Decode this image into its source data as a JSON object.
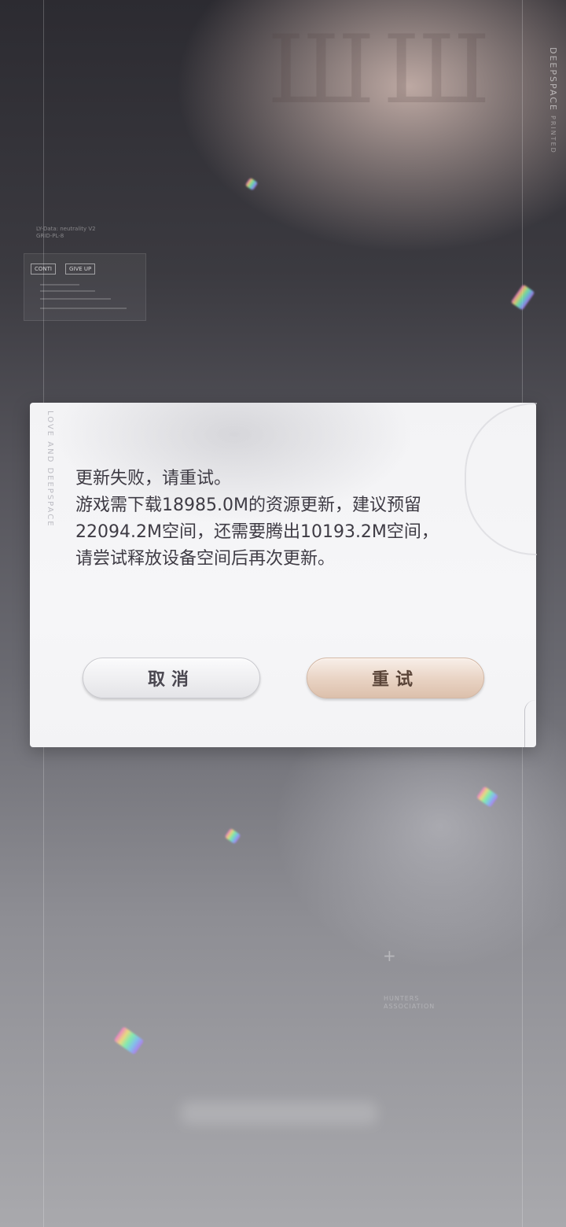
{
  "background": {
    "side_brand": "DEEPSPACE",
    "side_brand_sub": "PRINTED",
    "hud_small_lines": [
      "LY-Data: neutrality V2",
      "GRID-PL-8"
    ],
    "hud_chips": [
      "CONTI",
      "GIVE UP"
    ],
    "association_lines": [
      "HUNTERS",
      "ASSOCIATION"
    ]
  },
  "dialog": {
    "side_text": "LOVE AND DEEPSPACE",
    "message_lines": [
      "更新失败，请重试。",
      "游戏需下载18985.0M的资源更新，建议预留",
      "22094.2M空间，还需要腾出10193.2M空间，",
      "请尝试释放设备空间后再次更新。"
    ],
    "cancel_label": "取消",
    "retry_label": "重试"
  },
  "colors": {
    "dialog_bg": "#f4f4f6",
    "text": "#3e3b44",
    "retry_gold": "#e8d2c2"
  }
}
